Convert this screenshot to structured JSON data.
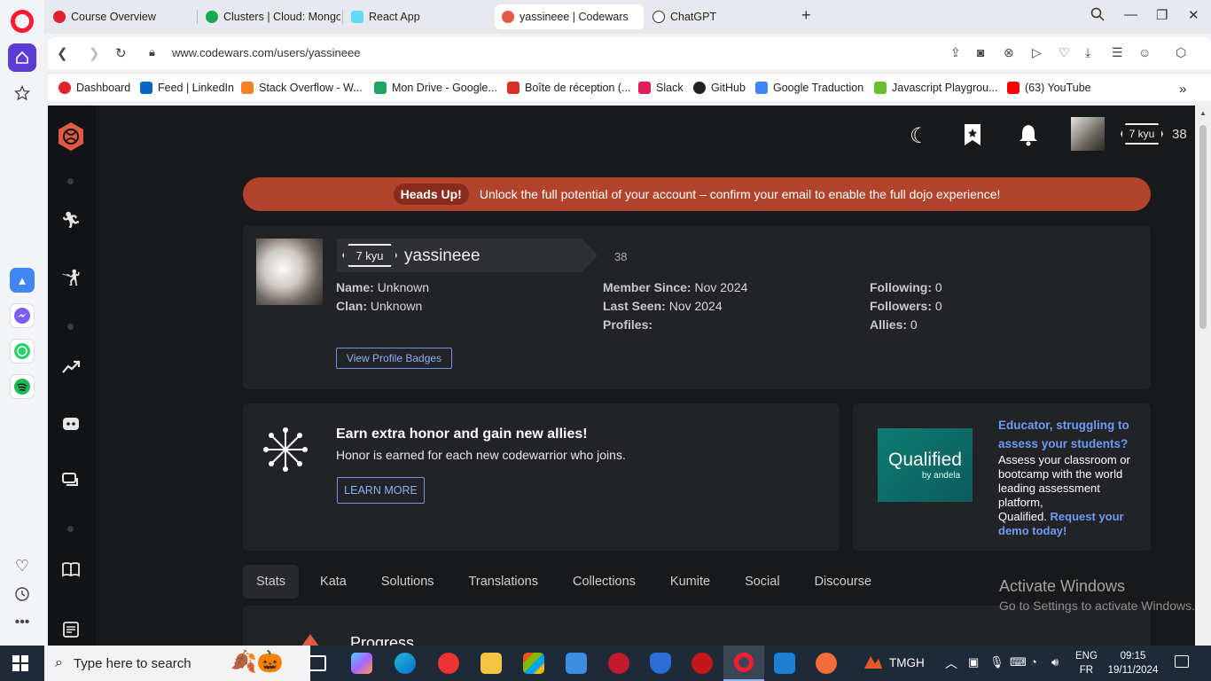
{
  "browser": {
    "tabs": [
      {
        "label": "Course Overview",
        "color": "#e0242d"
      },
      {
        "label": "Clusters | Cloud: MongoD",
        "color": "#13aa52"
      },
      {
        "label": "React App",
        "color": "#61dafb"
      },
      {
        "label": "yassineee | Codewars",
        "color": "#e05a45"
      },
      {
        "label": "ChatGPT",
        "color": "#333333"
      }
    ],
    "new_tab": "+",
    "url": "www.codewars.com/users/yassineee",
    "bookmarks": [
      {
        "label": "Dashboard",
        "color": "#e0242d"
      },
      {
        "label": "Feed | LinkedIn",
        "color": "#0a66c2"
      },
      {
        "label": "Stack Overflow - W...",
        "color": "#f48024"
      },
      {
        "label": "Mon Drive - Google...",
        "color": "#1fa463"
      },
      {
        "label": "Boîte de réception (...",
        "color": "#d93025"
      },
      {
        "label": "Slack",
        "color": "#e01e5a"
      },
      {
        "label": "GitHub",
        "color": "#222222"
      },
      {
        "label": "Google Traduction",
        "color": "#4285f4"
      },
      {
        "label": "Javascript Playgrou...",
        "color": "#6cbf2c"
      },
      {
        "label": "(63) YouTube",
        "color": "#ff0000"
      }
    ],
    "bookmarks_more": "»"
  },
  "codewars": {
    "header": {
      "rank": "7 kyu",
      "honor": "38"
    },
    "headsup": {
      "tag": "Heads Up!",
      "message": "Unlock the full potential of your account – confirm your email to enable the full dojo experience!"
    },
    "profile": {
      "rank": "7 kyu",
      "username": "yassineee",
      "honor": "38",
      "name_label": "Name:",
      "name_value": "Unknown",
      "clan_label": "Clan:",
      "clan_value": "Unknown",
      "member_since_label": "Member Since:",
      "member_since_value": "Nov 2024",
      "last_seen_label": "Last Seen:",
      "last_seen_value": "Nov 2024",
      "profiles_label": "Profiles:",
      "following_label": "Following:",
      "following_value": "0",
      "followers_label": "Followers:",
      "followers_value": "0",
      "allies_label": "Allies:",
      "allies_value": "0",
      "view_badges": "View Profile Badges"
    },
    "promo": {
      "title": "Earn extra honor and gain new allies!",
      "subtitle": "Honor is earned for each new codewarrior who joins.",
      "button": "LEARN MORE"
    },
    "ad": {
      "logo_text": "Qualified",
      "logo_sub": "by andela",
      "heading": "Educator, struggling to assess your students?",
      "body": "Assess your classroom or bootcamp with the world leading assessment platform,",
      "body2": "Qualified.",
      "cta": "Request your demo today!"
    },
    "tabs": [
      "Stats",
      "Kata",
      "Solutions",
      "Translations",
      "Collections",
      "Kumite",
      "Social",
      "Discourse"
    ],
    "section_title": "Progress"
  },
  "watermark": {
    "title": "Activate Windows",
    "subtitle": "Go to Settings to activate Windows."
  },
  "taskbar": {
    "search_placeholder": "Type here to search",
    "weather": "TMGH",
    "lang1": "ENG",
    "lang2": "FR",
    "time": "09:15",
    "date": "19/11/2024"
  }
}
